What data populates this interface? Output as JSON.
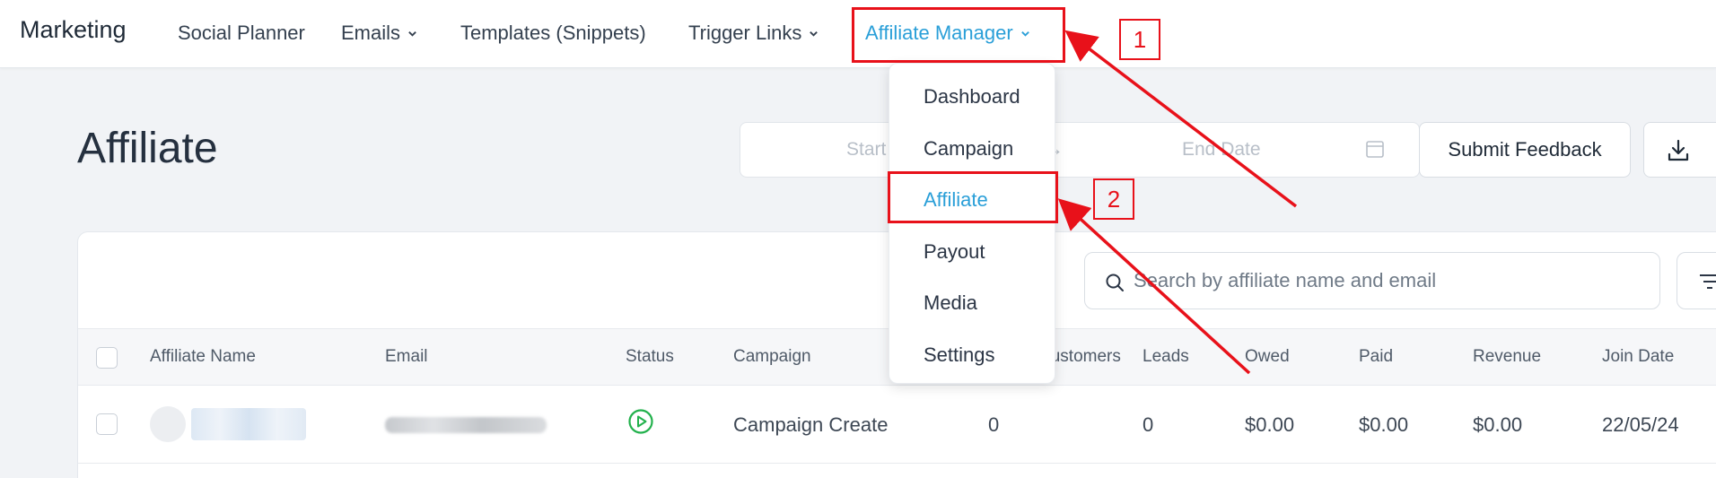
{
  "nav": {
    "brand": "Marketing",
    "items": [
      {
        "label": "Social Planner",
        "has_chevron": false
      },
      {
        "label": "Emails",
        "has_chevron": true
      },
      {
        "label": "Templates (Snippets)",
        "has_chevron": false
      },
      {
        "label": "Trigger Links",
        "has_chevron": true
      },
      {
        "label": "Affiliate Manager",
        "has_chevron": true,
        "active": true
      }
    ]
  },
  "dropdown": {
    "items": [
      {
        "label": "Dashboard"
      },
      {
        "label": "Campaign"
      },
      {
        "label": "Affiliate",
        "active": true
      },
      {
        "label": "Payout"
      },
      {
        "label": "Media"
      },
      {
        "label": "Settings"
      }
    ]
  },
  "page": {
    "title": "Affiliate",
    "date_start_placeholder": "Start Date",
    "date_end_placeholder": "End Date",
    "feedback_button": "Submit Feedback",
    "search_placeholder": "Search by affiliate name and email"
  },
  "table": {
    "headers": [
      "Affiliate Name",
      "Email",
      "Status",
      "Campaign",
      "Customers",
      "Leads",
      "Owed",
      "Paid",
      "Revenue",
      "Join Date"
    ],
    "rows": [
      {
        "campaign": "Campaign Create",
        "customers": "0",
        "leads": "0",
        "owed": "$0.00",
        "paid": "$0.00",
        "revenue": "$0.00",
        "join_date": "22/05/24"
      }
    ]
  },
  "annotations": {
    "label_1": "1",
    "label_2": "2"
  },
  "colors": {
    "accent": "#2a9fd8",
    "annotation": "#e8111a",
    "status_active": "#22b14c"
  }
}
